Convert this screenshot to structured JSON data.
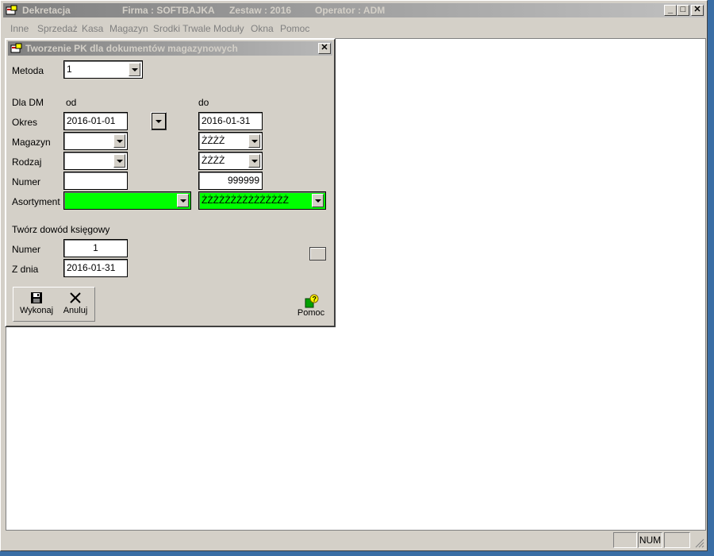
{
  "app": {
    "title": "Dekretacja",
    "firma": "Firma : SOFTBAJKA",
    "zestaw": "Zestaw : 2016",
    "operator": "Operator : ADM"
  },
  "menu": [
    "Inne",
    "Sprzedaż",
    "Kasa",
    "Magazyn",
    "Srodki Trwale",
    "Moduły",
    "Okna",
    "Pomoc"
  ],
  "dialog": {
    "title": "Tworzenie PK dla dokumentów magazynowych",
    "metoda_label": "Metoda",
    "metoda_value": "1",
    "dla_dm_label": "Dla DM",
    "od_label": "od",
    "do_label": "do",
    "okres_label": "Okres",
    "okres_od": "2016-01-01",
    "okres_do": "2016-01-31",
    "magazyn_label": "Magazyn",
    "magazyn_od": "",
    "magazyn_do": "ŻŻŻŻ",
    "rodzaj_label": "Rodzaj",
    "rodzaj_od": "",
    "rodzaj_do": "ŻŻŻŻ",
    "numer_label": "Numer",
    "numer_od": "",
    "numer_do": "999999",
    "asortyment_label": "Asortyment",
    "asortyment_od": "",
    "asortyment_do": "ŻŻŻŻŻŻŻŻŻŻŻŻŻŻŻ",
    "dowod_label": "Twórz dowód księgowy",
    "dowod_numer_label": "Numer",
    "dowod_numer": "1",
    "zdnia_label": "Z dnia",
    "zdnia_value": "2016-01-31",
    "wykonaj_label": "Wykonaj",
    "anuluj_label": "Anuluj",
    "pomoc_label": "Pomoc"
  },
  "status": {
    "num": "NUM"
  },
  "colors": {
    "highlight_green": "#00ff00",
    "desktop": "#3a6ea5",
    "face": "#d4d0c8"
  },
  "icons": [
    "app-icon",
    "minimize-icon",
    "maximize-icon",
    "close-icon",
    "save-disk-icon",
    "cancel-x-icon",
    "help-icon",
    "dropdown-arrow-icon",
    "size-grip-icon"
  ]
}
